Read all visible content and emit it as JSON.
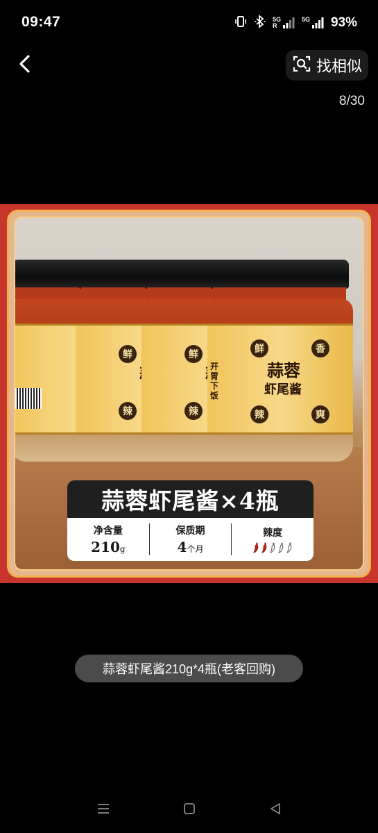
{
  "status_bar": {
    "time": "09:47",
    "net_top": "5G",
    "net_bottom": "R",
    "net_label_2": "5G",
    "battery": "93%"
  },
  "top_bar": {
    "find_similar_label": "找相似",
    "page_counter": "8/30"
  },
  "product_image": {
    "jar_badges": [
      "鲜",
      "香",
      "辣",
      "爽"
    ],
    "jar_title_line1": "蒜蓉",
    "jar_title_line2": "虾尾酱",
    "jar_side_text": "开胃下饭",
    "banner_title": "蒜蓉虾尾酱×4瓶",
    "specs": [
      {
        "label": "净含量",
        "value": "210",
        "unit": "g"
      },
      {
        "label": "保质期",
        "value": "4",
        "unit": "个月"
      },
      {
        "label": "辣度",
        "value": "",
        "unit": ""
      }
    ],
    "spice_level": 0.4
  },
  "caption": "蒜蓉虾尾酱210g*4瓶(老客回购)",
  "colors": {
    "background": "#000000",
    "image_red": "#c8352c",
    "frame_gold": "#f2b24a",
    "chip_bg": "#4b4b4b"
  },
  "icons": {
    "back": "chevron-left-icon",
    "find_similar": "image-search-icon",
    "nav_menu": "menu-icon",
    "nav_home": "home-icon",
    "nav_back": "back-triangle-icon"
  }
}
